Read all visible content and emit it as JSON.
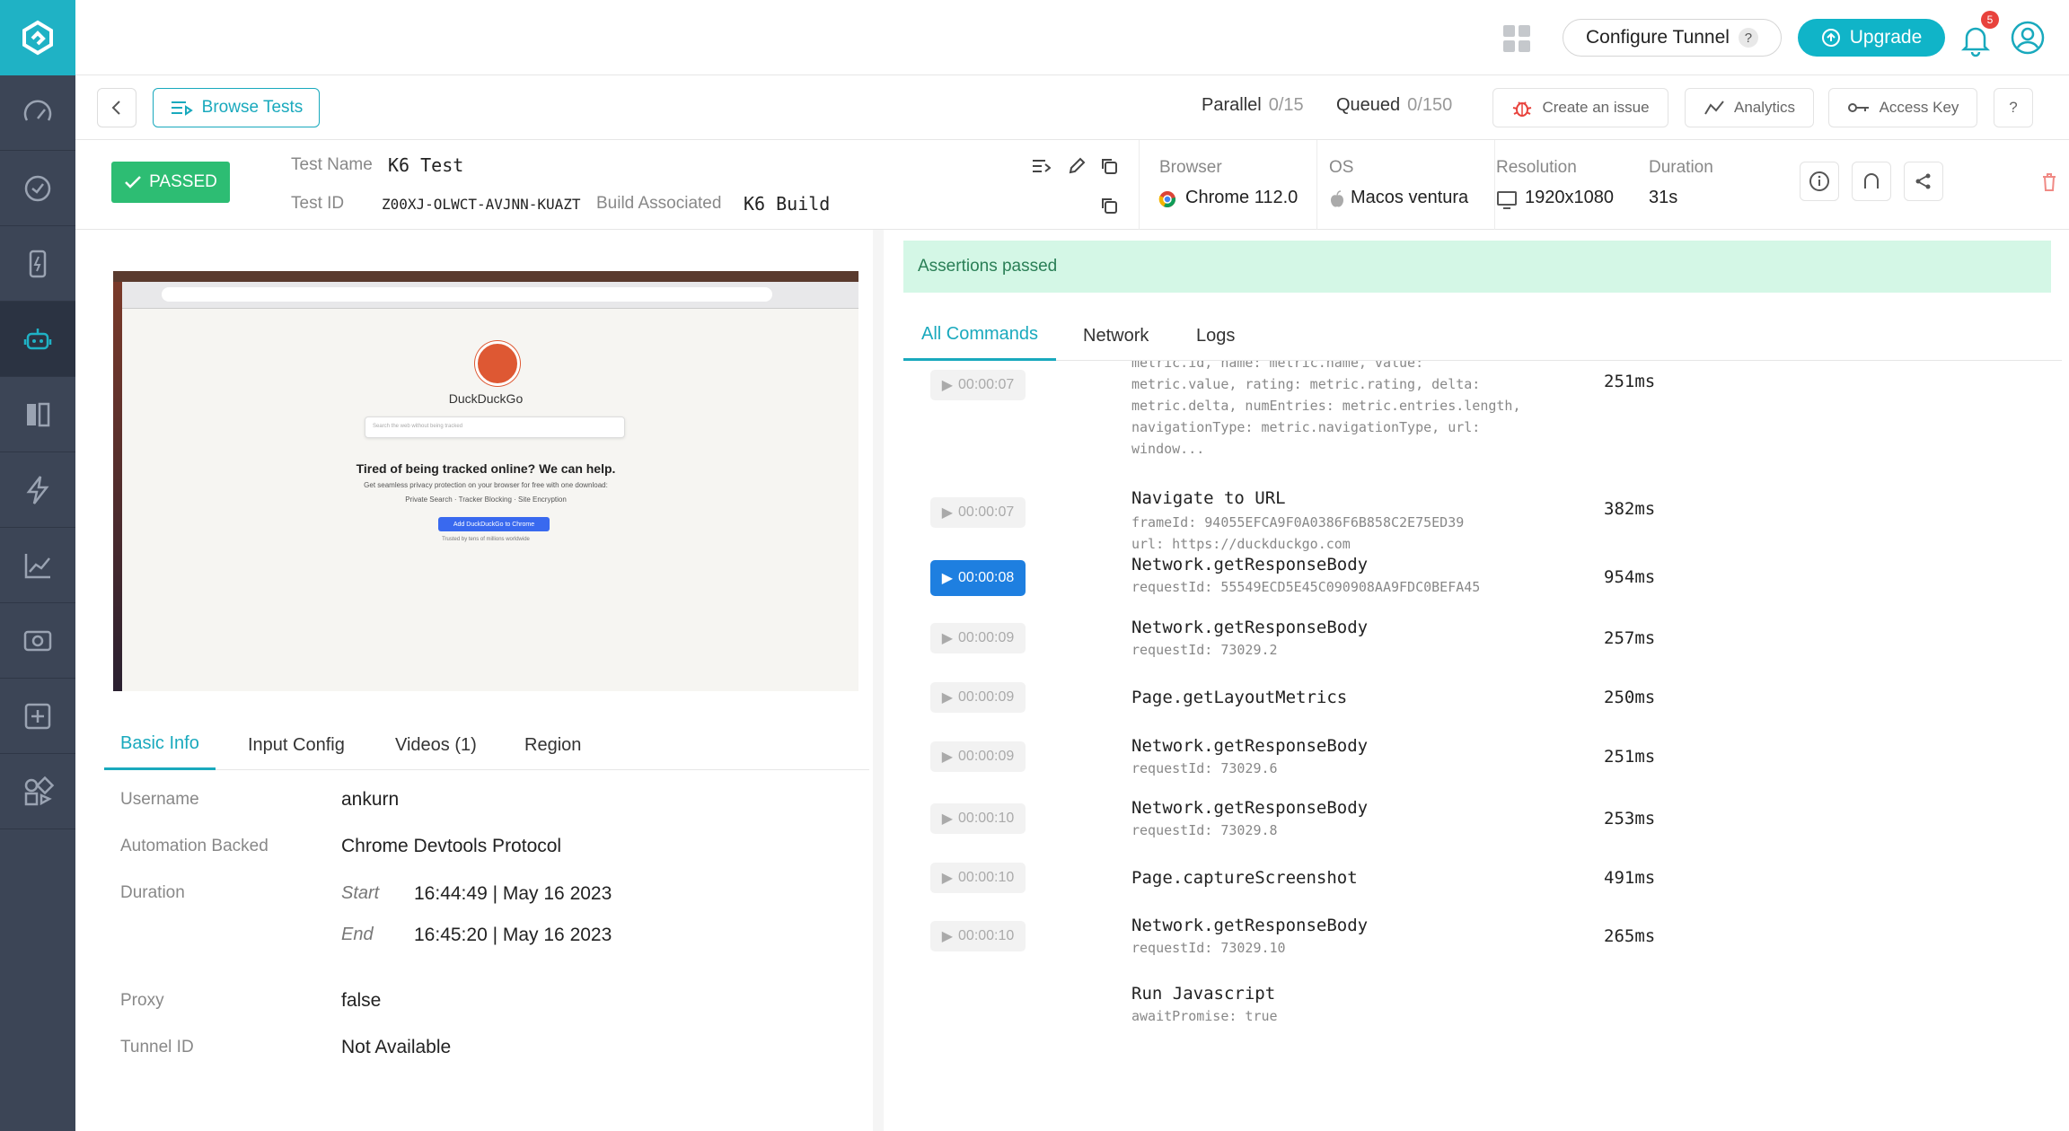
{
  "topbar": {
    "configure_label": "Configure Tunnel",
    "help_mark": "?",
    "upgrade_label": "Upgrade",
    "notification_count": "5"
  },
  "toolbar": {
    "browse_label": "Browse Tests",
    "parallel_label": "Parallel",
    "parallel_value": "0/15",
    "queued_label": "Queued",
    "queued_value": "0/150",
    "issue_label": "Create an issue",
    "analytics_label": "Analytics",
    "access_key_label": "Access Key",
    "help_label": "?"
  },
  "test": {
    "status": "PASSED",
    "name_label": "Test Name",
    "name": "K6 Test",
    "id_label": "Test ID",
    "id": "Z00XJ-OLWCT-AVJNN-KUAZT",
    "build_label": "Build Associated",
    "build": "K6 Build",
    "browser_label": "Browser",
    "browser": "Chrome 112.0",
    "os_label": "OS",
    "os": "Macos ventura",
    "resolution_label": "Resolution",
    "resolution": "1920x1080",
    "duration_label": "Duration",
    "duration": "31s"
  },
  "preview": {
    "brand": "DuckDuckGo",
    "search_placeholder": "Search the web without being tracked",
    "headline": "Tired of being tracked online? We can help.",
    "subline": "Get seamless privacy protection on your browser for free with one download:",
    "features": "Private Search · Tracker Blocking · Site Encryption",
    "cta": "Add DuckDuckGo to Chrome",
    "trust": "Trusted by tens of millions worldwide"
  },
  "left_tabs": [
    "Basic Info",
    "Input Config",
    "Videos (1)",
    "Region"
  ],
  "basic_info": {
    "username_label": "Username",
    "username": "ankurn",
    "automation_label": "Automation Backed",
    "automation": "Chrome Devtools Protocol",
    "duration_label": "Duration",
    "start_label": "Start",
    "start": "16:44:49 | May 16 2023",
    "end_label": "End",
    "end": "16:45:20 | May 16 2023",
    "proxy_label": "Proxy",
    "proxy": "false",
    "tunnel_label": "Tunnel ID",
    "tunnel": "Not Available"
  },
  "assertions": "Assertions passed",
  "right_tabs": [
    "All Commands",
    "Network",
    "Logs"
  ],
  "commands": [
    {
      "time": "00:00:07",
      "name": "",
      "detail": "metric.id, name: metric.name, value:\nmetric.value, rating: metric.rating, delta:\nmetric.delta, numEntries: metric.entries.length,\nnavigationType: metric.navigationType, url:\nwindow...",
      "dur": "251ms"
    },
    {
      "time": "00:00:07",
      "name": "Navigate to URL",
      "detail": "frameId: 94055EFCA9F0A0386F6B858C2E75ED39\nurl: https://duckduckgo.com",
      "dur": "382ms"
    },
    {
      "time": "00:00:08",
      "name": "Network.getResponseBody",
      "detail": "requestId: 55549ECD5E45C090908AA9FDC0BEFA45",
      "dur": "954ms"
    },
    {
      "time": "00:00:09",
      "name": "Network.getResponseBody",
      "detail": "requestId: 73029.2",
      "dur": "257ms"
    },
    {
      "time": "00:00:09",
      "name": "Page.getLayoutMetrics",
      "detail": "",
      "dur": "250ms"
    },
    {
      "time": "00:00:09",
      "name": "Network.getResponseBody",
      "detail": "requestId: 73029.6",
      "dur": "251ms"
    },
    {
      "time": "00:00:10",
      "name": "Network.getResponseBody",
      "detail": "requestId: 73029.8",
      "dur": "253ms"
    },
    {
      "time": "00:00:10",
      "name": "Page.captureScreenshot",
      "detail": "",
      "dur": "491ms"
    },
    {
      "time": "00:00:10",
      "name": "Network.getResponseBody",
      "detail": "requestId: 73029.10",
      "dur": "265ms"
    },
    {
      "time": "",
      "name": "Run Javascript",
      "detail": "awaitPromise: true",
      "dur": ""
    }
  ],
  "colors": {
    "accent": "#19a9bd",
    "sidebar": "#3c4556",
    "passed": "#2dbd73",
    "active_timestamp": "#1e7fe0"
  }
}
